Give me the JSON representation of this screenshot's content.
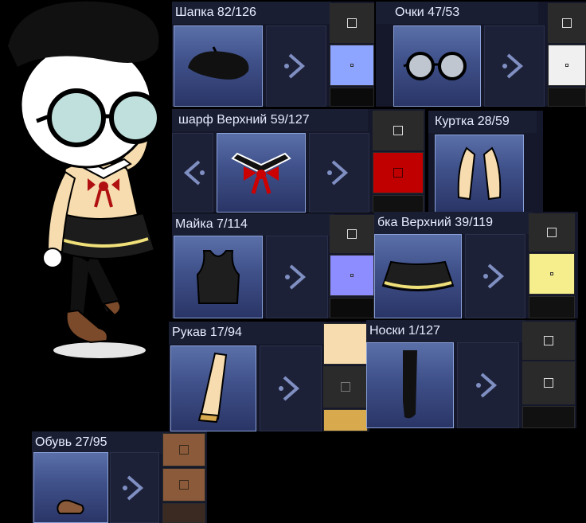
{
  "categories": [
    {
      "id": "hat",
      "label": "Шапка 82/126",
      "icon": "beret-icon",
      "swatches": [
        {
          "color": "#2a2a2a"
        },
        {
          "color": "#8ea5ff"
        },
        {
          "color": "#0b0b0b"
        }
      ]
    },
    {
      "id": "glasses",
      "label": "Очки 47/53",
      "icon": "round-glasses-icon",
      "swatches": [
        {
          "color": "#2a2a2a"
        },
        {
          "color": "#f0f0f0"
        },
        {
          "color": "#111111"
        }
      ]
    },
    {
      "id": "scarf",
      "label": "шарф Верхний 59/127",
      "icon": "sailor-collar-bow-icon",
      "swatches": [
        {
          "color": "#2a2a2a"
        },
        {
          "color": "#c00000"
        },
        {
          "color": "#111111"
        }
      ]
    },
    {
      "id": "jacket",
      "label": "Куртка 28/59",
      "icon": "vest-icon",
      "swatches": []
    },
    {
      "id": "tank",
      "label": "Майка 7/114",
      "icon": "tank-top-icon",
      "swatches": [
        {
          "color": "#2a2a2a"
        },
        {
          "color": "#8d8dff"
        },
        {
          "color": "#0b0b0b"
        }
      ]
    },
    {
      "id": "skirt",
      "label": "бка Верхний 39/119",
      "icon": "pleated-skirt-icon",
      "swatches": [
        {
          "color": "#2a2a2a"
        },
        {
          "color": "#f6ee8c"
        },
        {
          "color": "#111111"
        }
      ]
    },
    {
      "id": "sleeve",
      "label": "Рукав 17/94",
      "icon": "sleeve-icon",
      "swatches": [
        {
          "color": "#f6dcae"
        },
        {
          "color": "#2b2b2b"
        },
        {
          "color": "#d9a94d"
        }
      ]
    },
    {
      "id": "socks",
      "label": "Носки 1/127",
      "icon": "sock-icon",
      "swatches": [
        {
          "color": "#2a2a2a"
        },
        {
          "color": "#2a2a2a"
        },
        {
          "color": "#111111"
        }
      ]
    },
    {
      "id": "shoes",
      "label": "Обувь 27/95",
      "icon": "shoe-icon",
      "swatches": [
        {
          "color": "#8a5a3a"
        },
        {
          "color": "#8a5a3a"
        },
        {
          "color": "#3b2a22"
        }
      ]
    }
  ],
  "character": {
    "icon": "chibi-character-icon"
  }
}
